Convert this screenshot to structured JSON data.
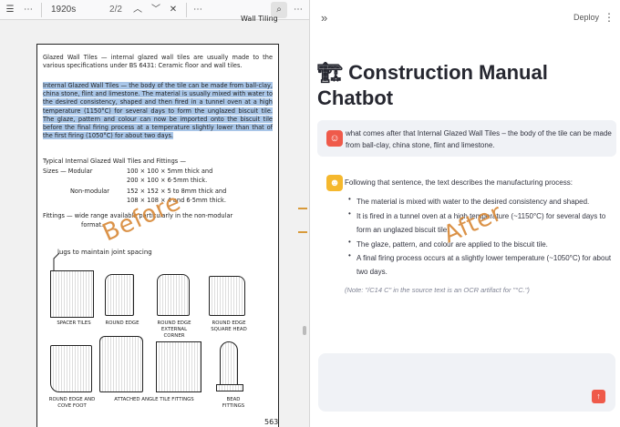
{
  "pdf_viewer": {
    "toolbar": {
      "sidebar_icon": "☰",
      "more_icon": "⋯",
      "search_value": "1920s",
      "match_count": "2/2",
      "prev_icon": "︿",
      "next_icon": "﹀",
      "close_icon": "✕",
      "options_icon": "⋯",
      "find_icon": "⌕",
      "overflow_icon": "⋯"
    },
    "page": {
      "header": "Wall Tiling",
      "para1": "Glazed Wall Tiles — internal glazed wall tiles are usually made to the various specifications under BS 6431: Ceramic floor and wall tiles.",
      "para2_highlighted": "Internal Glazed Wall Tiles — the body of the tile can be made from ball-clay, china stone, flint and limestone. The material is usually mixed with water to the desired consistency, shaped and then fired in a tunnel oven at a high temperature (1150°C) for several days to form the unglazed biscuit tile. The glaze, pattern and colour can now be imported onto the biscuit tile before the final firing process at a temperature slightly lower than that of the first firing (1050°C) for about two days.",
      "typical_heading": "Typical Internal Glazed Wall Tiles and Fittings —",
      "sizes_label": "Sizes — Modular",
      "sizes_modular_1": "100 × 100 × 5mm thick and",
      "sizes_modular_2": "200 × 100 × 6·5mm thick.",
      "non_modular_label": "Non-modular",
      "non_modular_1": "152 × 152 × 5 to 8mm thick and",
      "non_modular_2": "108 × 108 × 4 and 6·5mm thick.",
      "fittings_line1": "Fittings — wide range available particularly in the non-modular",
      "fittings_line2": "format.",
      "lugs_label": "lugs to maintain joint spacing",
      "tile_labels": {
        "spacer": "SPACER TILES",
        "round_edge": "ROUND EDGE",
        "round_edge_external": "ROUND EDGE\nEXTERNAL\nCORNER",
        "round_edge_square": "ROUND EDGE\nSQUARE HEAD",
        "cove_foot": "ROUND EDGE AND\nCOVE FOOT",
        "attached_angle": "ATTACHED ANGLE TILE FITTINGS",
        "bead": "BEAD\nFITTINGS"
      },
      "page_number": "563"
    },
    "watermark_before": "Before"
  },
  "chat": {
    "expand_icon": "»",
    "deploy_label": "Deploy",
    "menu_icon": "⋮",
    "title_icon": "🏗",
    "title": "Construction Manual Chatbot",
    "user_message": "what comes after that Internal Glazed Wall Tiles – the body of the tile can be made from ball-clay, china stone, flint and limestone.",
    "assistant_intro": "Following that sentence, the text describes the manufacturing process:",
    "bullets": [
      "The material is mixed with water to the desired consistency and shaped.",
      "It is fired in a tunnel oven at a high temperature (~1150°C) for several days to",
      "form an unglazed biscuit tile.",
      "The glaze, pattern, and colour are applied to the biscuit tile.",
      "A final firing process occurs at a slightly lower temperature (~1050°C) for about",
      "two days."
    ],
    "note": "(Note: \"/C14 C\" in the source text is an OCR artifact for \"°C.\")",
    "send_icon": "↑",
    "watermark_after": "After"
  },
  "colors": {
    "highlight": "#a9c6e8",
    "user_avatar": "#ef5a4a",
    "assistant_avatar": "#f5b82e",
    "send_button": "#ef5a4a",
    "watermark": "#d88a3a"
  }
}
